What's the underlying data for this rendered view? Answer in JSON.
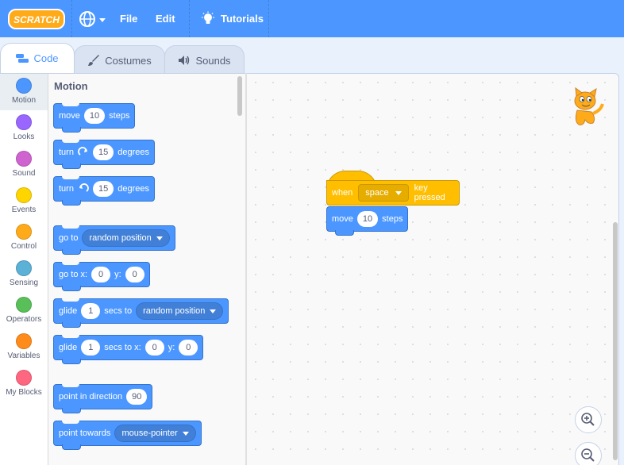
{
  "menubar": {
    "logo_text": "SCRATCH",
    "file": "File",
    "edit": "Edit",
    "tutorials": "Tutorials"
  },
  "tabs": [
    {
      "label": "Code",
      "icon": "code-icon",
      "active": true
    },
    {
      "label": "Costumes",
      "icon": "brush-icon",
      "active": false
    },
    {
      "label": "Sounds",
      "icon": "speaker-icon",
      "active": false
    }
  ],
  "categories": [
    {
      "label": "Motion",
      "color": "#4c97ff"
    },
    {
      "label": "Looks",
      "color": "#9966ff"
    },
    {
      "label": "Sound",
      "color": "#cf63cf"
    },
    {
      "label": "Events",
      "color": "#ffd500"
    },
    {
      "label": "Control",
      "color": "#ffab19"
    },
    {
      "label": "Sensing",
      "color": "#5cb1d6"
    },
    {
      "label": "Operators",
      "color": "#59c059"
    },
    {
      "label": "Variables",
      "color": "#ff8c1a"
    },
    {
      "label": "My Blocks",
      "color": "#ff6680"
    }
  ],
  "palette": {
    "title": "Motion",
    "blocks": {
      "move": {
        "t1": "move",
        "v1": "10",
        "t2": "steps"
      },
      "turn_right": {
        "t1": "turn",
        "v1": "15",
        "t2": "degrees"
      },
      "turn_left": {
        "t1": "turn",
        "v1": "15",
        "t2": "degrees"
      },
      "goto": {
        "t1": "go to",
        "dd": "random position"
      },
      "goto_xy": {
        "t1": "go to x:",
        "v1": "0",
        "t2": "y:",
        "v2": "0"
      },
      "glide_to": {
        "t1": "glide",
        "v1": "1",
        "t2": "secs to",
        "dd": "random position"
      },
      "glide_xy": {
        "t1": "glide",
        "v1": "1",
        "t2": "secs to x:",
        "v2": "0",
        "t3": "y:",
        "v3": "0"
      },
      "point_dir": {
        "t1": "point in direction",
        "v1": "90"
      },
      "point_towards": {
        "t1": "point towards",
        "dd": "mouse-pointer"
      }
    }
  },
  "script": {
    "hat": {
      "t1": "when",
      "dd": "space",
      "t2": "key pressed"
    },
    "move": {
      "t1": "move",
      "v1": "10",
      "t2": "steps"
    }
  },
  "colors": {
    "menubar": "#4c97ff",
    "motion": "#4c97ff",
    "events": "#ffbf00"
  }
}
